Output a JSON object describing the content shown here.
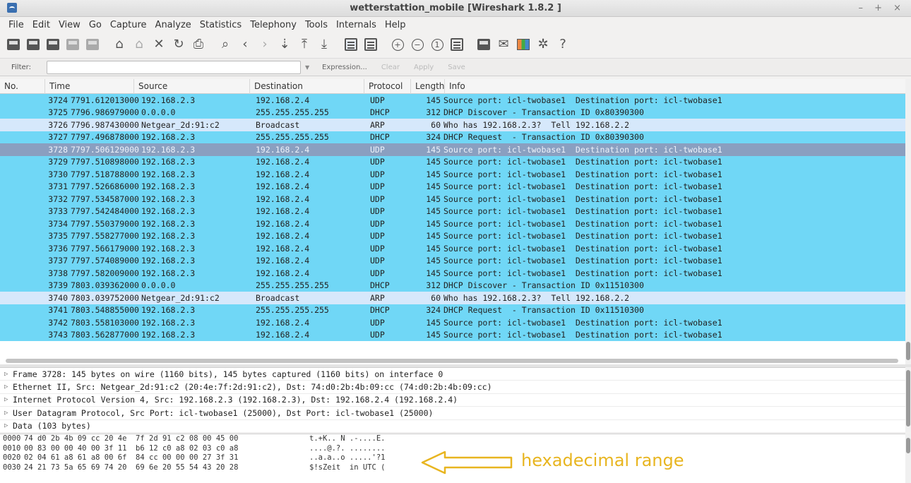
{
  "window": {
    "title": "wetterstattion_mobile  [Wireshark 1.8.2 ]",
    "controls": "– + ×"
  },
  "menu": [
    "File",
    "Edit",
    "View",
    "Go",
    "Capture",
    "Analyze",
    "Statistics",
    "Telephony",
    "Tools",
    "Internals",
    "Help"
  ],
  "toolbar_icons": [
    "interface-list-icon",
    "capture-options-icon",
    "start-capture-icon",
    "stop-capture-icon",
    "restart-capture-icon",
    "open-file-icon",
    "save-file-icon",
    "close-file-icon",
    "reload-icon",
    "print-icon",
    "find-icon",
    "go-back-icon",
    "go-forward-icon",
    "go-to-packet-icon",
    "go-first-icon",
    "go-last-icon",
    "colorize-icon",
    "autoscroll-icon",
    "zoom-in-icon",
    "zoom-out-icon",
    "zoom-normal-icon",
    "resize-columns-icon",
    "capture-filters-icon",
    "display-filters-icon",
    "coloring-rules-icon",
    "preferences-icon",
    "help-icon"
  ],
  "filter": {
    "label": "Filter:",
    "value": "",
    "expression_label": "Expression...",
    "clear_label": "Clear",
    "apply_label": "Apply",
    "save_label": "Save"
  },
  "packet_list": {
    "columns": [
      "No.",
      "Time",
      "Source",
      "Destination",
      "Protocol",
      "Length",
      "Info"
    ],
    "rows": [
      {
        "no": "3724",
        "time": "7791.612013000",
        "src": "192.168.2.3",
        "dst": "192.168.2.4",
        "proto": "UDP",
        "len": "145",
        "info": "Source port: icl-twobase1  Destination port: icl-twobase1",
        "color": "udp"
      },
      {
        "no": "3725",
        "time": "7796.986979000",
        "src": "0.0.0.0",
        "dst": "255.255.255.255",
        "proto": "DHCP",
        "len": "312",
        "info": "DHCP Discover - Transaction ID 0x80390300",
        "color": "udp"
      },
      {
        "no": "3726",
        "time": "7796.987430000",
        "src": "Netgear_2d:91:c2",
        "dst": "Broadcast",
        "proto": "ARP",
        "len": "60",
        "info": "Who has 192.168.2.3?  Tell 192.168.2.2",
        "color": "arp"
      },
      {
        "no": "3727",
        "time": "7797.496878000",
        "src": "192.168.2.3",
        "dst": "255.255.255.255",
        "proto": "DHCP",
        "len": "324",
        "info": "DHCP Request  - Transaction ID 0x80390300",
        "color": "udp"
      },
      {
        "no": "3728",
        "time": "7797.506129000",
        "src": "192.168.2.3",
        "dst": "192.168.2.4",
        "proto": "UDP",
        "len": "145",
        "info": "Source port: icl-twobase1  Destination port: icl-twobase1",
        "color": "sel"
      },
      {
        "no": "3729",
        "time": "7797.510898000",
        "src": "192.168.2.3",
        "dst": "192.168.2.4",
        "proto": "UDP",
        "len": "145",
        "info": "Source port: icl-twobase1  Destination port: icl-twobase1",
        "color": "udp"
      },
      {
        "no": "3730",
        "time": "7797.518788000",
        "src": "192.168.2.3",
        "dst": "192.168.2.4",
        "proto": "UDP",
        "len": "145",
        "info": "Source port: icl-twobase1  Destination port: icl-twobase1",
        "color": "udp"
      },
      {
        "no": "3731",
        "time": "7797.526686000",
        "src": "192.168.2.3",
        "dst": "192.168.2.4",
        "proto": "UDP",
        "len": "145",
        "info": "Source port: icl-twobase1  Destination port: icl-twobase1",
        "color": "udp"
      },
      {
        "no": "3732",
        "time": "7797.534587000",
        "src": "192.168.2.3",
        "dst": "192.168.2.4",
        "proto": "UDP",
        "len": "145",
        "info": "Source port: icl-twobase1  Destination port: icl-twobase1",
        "color": "udp"
      },
      {
        "no": "3733",
        "time": "7797.542484000",
        "src": "192.168.2.3",
        "dst": "192.168.2.4",
        "proto": "UDP",
        "len": "145",
        "info": "Source port: icl-twobase1  Destination port: icl-twobase1",
        "color": "udp"
      },
      {
        "no": "3734",
        "time": "7797.550379000",
        "src": "192.168.2.3",
        "dst": "192.168.2.4",
        "proto": "UDP",
        "len": "145",
        "info": "Source port: icl-twobase1  Destination port: icl-twobase1",
        "color": "udp"
      },
      {
        "no": "3735",
        "time": "7797.558277000",
        "src": "192.168.2.3",
        "dst": "192.168.2.4",
        "proto": "UDP",
        "len": "145",
        "info": "Source port: icl-twobase1  Destination port: icl-twobase1",
        "color": "udp"
      },
      {
        "no": "3736",
        "time": "7797.566179000",
        "src": "192.168.2.3",
        "dst": "192.168.2.4",
        "proto": "UDP",
        "len": "145",
        "info": "Source port: icl-twobase1  Destination port: icl-twobase1",
        "color": "udp"
      },
      {
        "no": "3737",
        "time": "7797.574089000",
        "src": "192.168.2.3",
        "dst": "192.168.2.4",
        "proto": "UDP",
        "len": "145",
        "info": "Source port: icl-twobase1  Destination port: icl-twobase1",
        "color": "udp"
      },
      {
        "no": "3738",
        "time": "7797.582009000",
        "src": "192.168.2.3",
        "dst": "192.168.2.4",
        "proto": "UDP",
        "len": "145",
        "info": "Source port: icl-twobase1  Destination port: icl-twobase1",
        "color": "udp"
      },
      {
        "no": "3739",
        "time": "7803.039362000",
        "src": "0.0.0.0",
        "dst": "255.255.255.255",
        "proto": "DHCP",
        "len": "312",
        "info": "DHCP Discover - Transaction ID 0x11510300",
        "color": "udp"
      },
      {
        "no": "3740",
        "time": "7803.039752000",
        "src": "Netgear_2d:91:c2",
        "dst": "Broadcast",
        "proto": "ARP",
        "len": "60",
        "info": "Who has 192.168.2.3?  Tell 192.168.2.2",
        "color": "arp"
      },
      {
        "no": "3741",
        "time": "7803.548855000",
        "src": "192.168.2.3",
        "dst": "255.255.255.255",
        "proto": "DHCP",
        "len": "324",
        "info": "DHCP Request  - Transaction ID 0x11510300",
        "color": "udp"
      },
      {
        "no": "3742",
        "time": "7803.558103000",
        "src": "192.168.2.3",
        "dst": "192.168.2.4",
        "proto": "UDP",
        "len": "145",
        "info": "Source port: icl-twobase1  Destination port: icl-twobase1",
        "color": "udp"
      },
      {
        "no": "3743",
        "time": "7803.562877000",
        "src": "192.168.2.3",
        "dst": "192.168.2.4",
        "proto": "UDP",
        "len": "145",
        "info": "Source port: icl-twobase1  Destination port: icl-twobase1",
        "color": "udp"
      }
    ]
  },
  "details": [
    "Frame 3728: 145 bytes on wire (1160 bits), 145 bytes captured (1160 bits) on interface 0",
    "Ethernet II, Src: Netgear_2d:91:c2 (20:4e:7f:2d:91:c2), Dst: 74:d0:2b:4b:09:cc (74:d0:2b:4b:09:cc)",
    "Internet Protocol Version 4, Src: 192.168.2.3 (192.168.2.3), Dst: 192.168.2.4 (192.168.2.4)",
    "User Datagram Protocol, Src Port: icl-twobase1 (25000), Dst Port: icl-twobase1 (25000)",
    "Data (103 bytes)"
  ],
  "hex": [
    {
      "off": "0000",
      "hex": "74 d0 2b 4b 09 cc 20 4e  7f 2d 91 c2 08 00 45 00",
      "ascii": "t.+K.. N .-....E."
    },
    {
      "off": "0010",
      "hex": "00 83 00 00 40 00 3f 11  b6 12 c0 a8 02 03 c0 a8",
      "ascii": "....@.?. ........"
    },
    {
      "off": "0020",
      "hex": "02 04 61 a8 61 a8 00 6f  84 cc 00 00 00 27 3f 31",
      "ascii": "..a.a..o .....'?1"
    },
    {
      "off": "0030",
      "hex": "24 21 73 5a 65 69 74 20  69 6e 20 55 54 43 20 28",
      "ascii": "$!sZeit  in UTC ("
    }
  ],
  "annotation": {
    "label": "hexadecimal range",
    "color": "#e8b520"
  }
}
